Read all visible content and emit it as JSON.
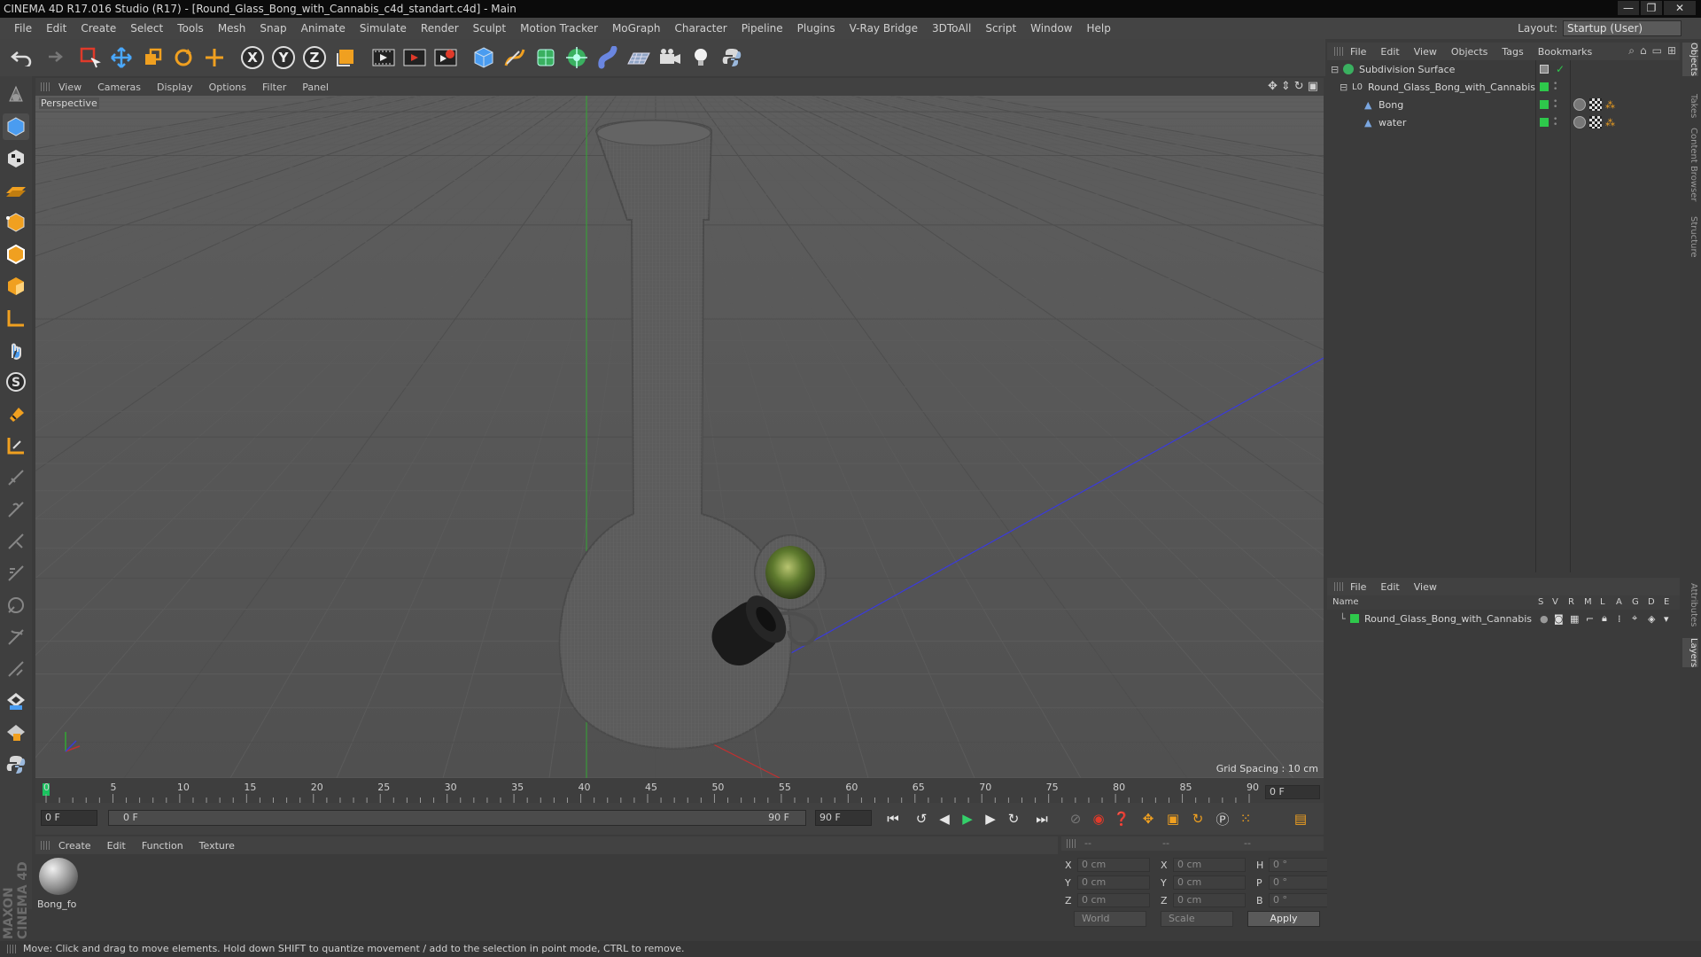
{
  "window": {
    "title": "CINEMA 4D R17.016 Studio (R17) - [Round_Glass_Bong_with_Cannabis_c4d_standart.c4d] - Main",
    "minimize_glyph": "—",
    "maximize_glyph": "❐",
    "close_glyph": "✕"
  },
  "menu": [
    "File",
    "Edit",
    "Create",
    "Select",
    "Tools",
    "Mesh",
    "Snap",
    "Animate",
    "Simulate",
    "Render",
    "Sculpt",
    "Motion Tracker",
    "MoGraph",
    "Character",
    "Pipeline",
    "Plugins",
    "V-Ray Bridge",
    "3DToAll",
    "Script",
    "Window",
    "Help"
  ],
  "layout": {
    "label": "Layout:",
    "value": "Startup (User)"
  },
  "toolbar": {
    "axis_x": "X",
    "axis_y": "Y",
    "axis_z": "Z"
  },
  "viewport": {
    "menu": [
      "View",
      "Cameras",
      "Display",
      "Options",
      "Filter",
      "Panel"
    ],
    "label": "Perspective",
    "grid_spacing": "Grid Spacing : 10 cm"
  },
  "timeline": {
    "ticks": [
      "0",
      "5",
      "10",
      "15",
      "20",
      "25",
      "30",
      "35",
      "40",
      "45",
      "50",
      "55",
      "60",
      "65",
      "70",
      "75",
      "80",
      "85",
      "90"
    ],
    "current_frame": "0 F",
    "start_field": "0 F",
    "range_start": "0 F",
    "range_end": "90 F",
    "end_field": "90 F"
  },
  "material_manager": {
    "menu": [
      "Create",
      "Edit",
      "Function",
      "Texture"
    ],
    "materials": [
      {
        "name": "Bong_fo"
      }
    ]
  },
  "coordinates": {
    "header": [
      "--",
      "--",
      "--"
    ],
    "rows": [
      {
        "l1": "X",
        "v1": "0 cm",
        "l2": "X",
        "v2": "0 cm",
        "l3": "H",
        "v3": "0 °"
      },
      {
        "l1": "Y",
        "v1": "0 cm",
        "l2": "Y",
        "v2": "0 cm",
        "l3": "P",
        "v3": "0 °"
      },
      {
        "l1": "Z",
        "v1": "0 cm",
        "l2": "Z",
        "v2": "0 cm",
        "l3": "B",
        "v3": "0 °"
      }
    ],
    "coord_system": "World",
    "mode": "Scale",
    "apply_label": "Apply"
  },
  "object_manager": {
    "menu": [
      "File",
      "Edit",
      "View",
      "Objects",
      "Tags",
      "Bookmarks"
    ],
    "objects": [
      {
        "name": "Subdivision Surface",
        "check": "✓"
      },
      {
        "name": "Round_Glass_Bong_with_Cannabis"
      },
      {
        "name": "Bong"
      },
      {
        "name": "water"
      }
    ]
  },
  "layer_manager": {
    "menu": [
      "File",
      "Edit",
      "View"
    ],
    "columns": [
      "Name",
      "S",
      "V",
      "R",
      "M",
      "L",
      "A",
      "G",
      "D",
      "E"
    ],
    "layers": [
      {
        "name": "Round_Glass_Bong_with_Cannabis"
      }
    ]
  },
  "right_tabs": [
    "Objects",
    "Takes",
    "Content Browser",
    "Structure",
    "Attributes",
    "Layers"
  ],
  "status": "Move: Click and drag to move elements. Hold down SHIFT to quantize movement / add to the selection in point mode, CTRL to remove.",
  "brand": "MAXON CINEMA 4D",
  "colors": {
    "layer_green": "#2ec84b",
    "playhead": "#19c35f",
    "axis_blue": "#3a3adc",
    "axis_green": "#33a833",
    "axis_red": "#c03030"
  }
}
